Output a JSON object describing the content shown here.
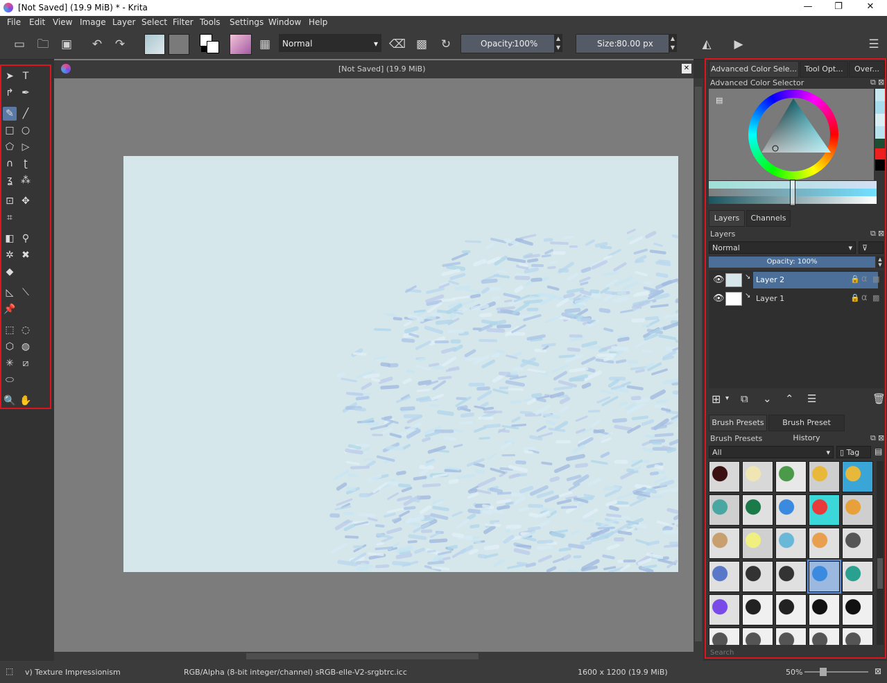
{
  "window": {
    "title": "[Not Saved]  (19.9 MiB) * - Krita",
    "minimize": "—",
    "maximize": "❐",
    "close": "✕"
  },
  "menu": [
    "File",
    "Edit",
    "View",
    "Image",
    "Layer",
    "Select",
    "Filter",
    "Tools",
    "Settings",
    "Window",
    "Help"
  ],
  "toolbar": {
    "blend_mode": "Normal",
    "opacity_label": "Opacity:",
    "opacity_value": "100%",
    "size_label": "Size:",
    "size_value": "80.00 px"
  },
  "document": {
    "tab_title": "[Not Saved]  (19.9 MiB)"
  },
  "docker": {
    "top_tabs": [
      "Advanced Color Sele...",
      "Tool Opt...",
      "Over..."
    ],
    "color_selector_title": "Advanced Color Selector",
    "layers_tabs": [
      "Layers",
      "Channels"
    ],
    "layers_title": "Layers",
    "layers_blend": "Normal",
    "layers_opacity": "Opacity:  100%",
    "layers": [
      {
        "name": "Layer 2",
        "selected": true
      },
      {
        "name": "Layer 1",
        "selected": false
      }
    ],
    "brush_tabs": [
      "Brush Presets",
      "Brush Preset History"
    ],
    "brush_title": "Brush Presets",
    "brush_filter": "All",
    "brush_tag": "Tag",
    "search_placeholder": "Search"
  },
  "status": {
    "brush": "v) Texture Impressionism",
    "color_space": "RGB/Alpha (8-bit integer/channel)  sRGB-elle-V2-srgbtrc.icc",
    "dimensions": "1600 x 1200 (19.9 MiB)",
    "zoom": "50%"
  },
  "colors": {
    "accent": "#e0141e",
    "canvas_bg": "#d6e7ec",
    "selected_layer": "#4c6f99"
  }
}
